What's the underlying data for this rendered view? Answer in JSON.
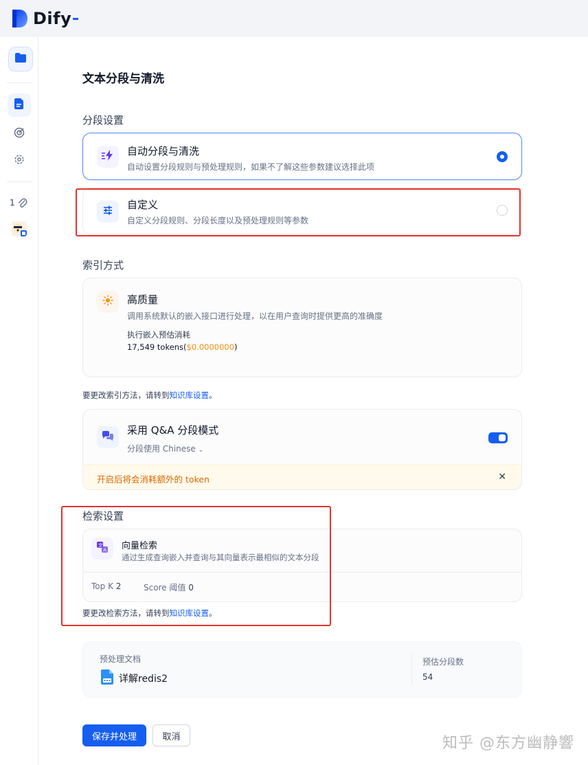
{
  "app": {
    "name": "Dify"
  },
  "page": {
    "title": "文本分段与清洗"
  },
  "segmentation": {
    "section_title": "分段设置",
    "options": [
      {
        "title": "自动分段与清洗",
        "desc": "自动设置分段规则与预处理规则，如果不了解这些参数建议选择此项",
        "selected": true
      },
      {
        "title": "自定义",
        "desc": "自定义分段规则、分段长度以及预处理规则等参数",
        "selected": false
      }
    ]
  },
  "index": {
    "section_title": "索引方式",
    "title": "高质量",
    "desc": "调用系统默认的嵌入接口进行处理，以在用户查询时提供更高的准确度",
    "cost_label": "执行嵌入预估消耗",
    "tokens": "17,549 tokens(",
    "price": "$0.0000000",
    "tokens_close": ")",
    "hint_prefix": "要更改索引方法，请转到",
    "hint_link": "知识库设置",
    "hint_suffix": "。"
  },
  "qa": {
    "title": "采用 Q&A 分段模式",
    "lang_prefix": "分段使用",
    "lang": "Chinese",
    "toggle_on": true,
    "warning": "开启后将会消耗额外的 token"
  },
  "retrieval": {
    "section_title": "检索设置",
    "title": "向量检索",
    "desc": "通过生成查询嵌入并查询与其向量表示最相似的文本分段",
    "top_k_label": "Top K",
    "top_k": "2",
    "score_label": "Score 阈值",
    "score": "0",
    "hint_prefix": "要更改检索方法，请转到",
    "hint_link": "知识库设置",
    "hint_suffix": "。"
  },
  "preview": {
    "doc_label": "预处理文档",
    "doc_name": "详解redis2",
    "count_label": "预估分段数",
    "count": "54"
  },
  "actions": {
    "save": "保存并处理",
    "cancel": "取消"
  },
  "sidebar": {
    "attachment_count": "1"
  },
  "watermark": "知乎 @东方幽静響",
  "colors": {
    "accent": "#155eef",
    "annotation_red": "#e5322d",
    "warning_bg": "#fffaeb",
    "warning_text": "#dc6803",
    "price": "#f79009"
  }
}
